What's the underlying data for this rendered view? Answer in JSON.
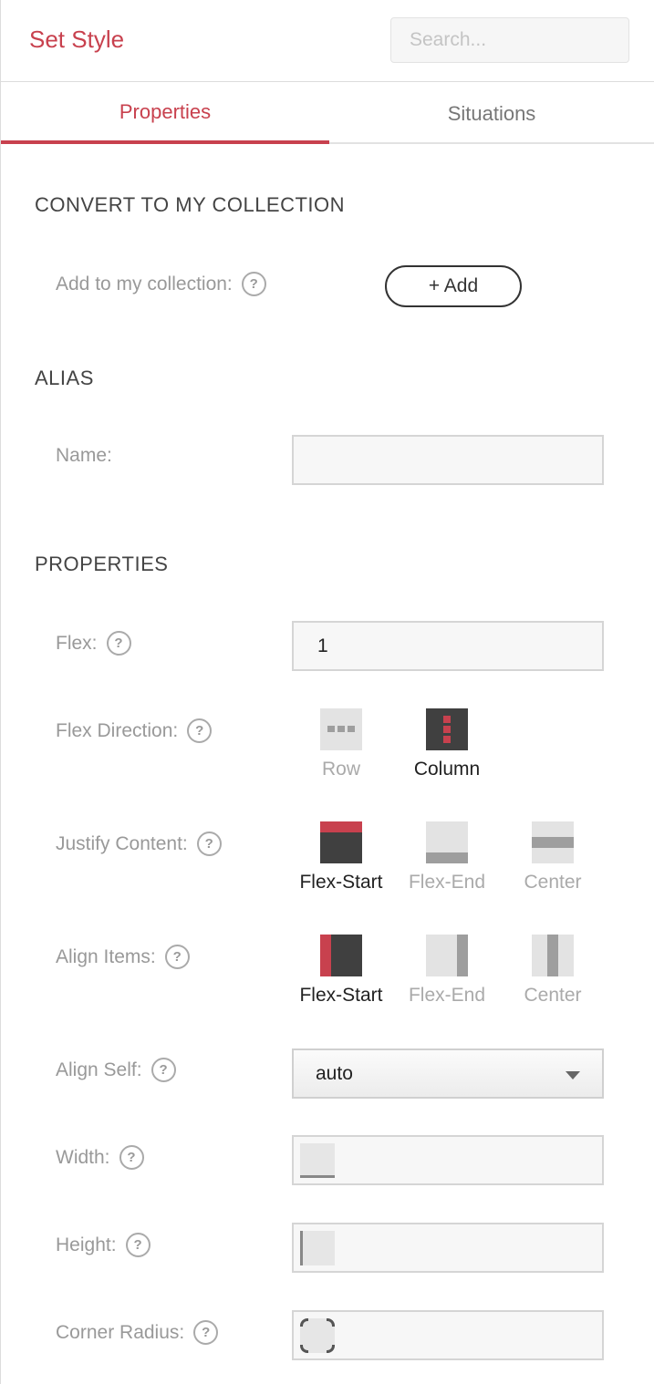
{
  "header": {
    "title": "Set Style",
    "search_placeholder": "Search..."
  },
  "tabs": [
    {
      "label": "Properties",
      "active": true
    },
    {
      "label": "Situations",
      "active": false
    }
  ],
  "convert": {
    "section_title": "CONVERT TO MY COLLECTION",
    "label": "Add to my collection:",
    "button_label": "+ Add"
  },
  "alias": {
    "section_title": "ALIAS",
    "name_label": "Name:",
    "name_value": ""
  },
  "properties": {
    "section_title": "PROPERTIES",
    "flex": {
      "label": "Flex:",
      "value": "1"
    },
    "flex_direction": {
      "label": "Flex Direction:",
      "options": [
        "Row",
        "Column"
      ],
      "selected": "Column"
    },
    "justify_content": {
      "label": "Justify Content:",
      "options": [
        "Flex-Start",
        "Flex-End",
        "Center"
      ],
      "selected": "Flex-Start"
    },
    "align_items": {
      "label": "Align Items:",
      "options": [
        "Flex-Start",
        "Flex-End",
        "Center"
      ],
      "selected": "Flex-Start"
    },
    "align_self": {
      "label": "Align Self:",
      "value": "auto"
    },
    "width": {
      "label": "Width:"
    },
    "height": {
      "label": "Height:"
    },
    "corner_radius": {
      "label": "Corner Radius:"
    }
  },
  "help_glyph": "?",
  "colors": {
    "accent": "#c8414e",
    "dark": "#404040",
    "light": "#e3e3e3",
    "mid": "#9e9e9e"
  }
}
